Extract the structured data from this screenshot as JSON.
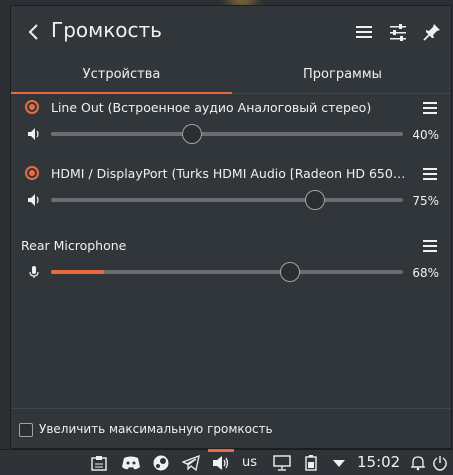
{
  "window": {
    "title": "Громкость",
    "tabs": [
      {
        "label": "Устройства",
        "active": true
      },
      {
        "label": "Программы",
        "active": false
      }
    ]
  },
  "devices": [
    {
      "name": "Line Out (Встроенное аудио Аналоговый стерео)",
      "selected": true,
      "volume_percent": 40,
      "volume_label": "40%",
      "fill_percent": 0,
      "icon": "speaker-icon"
    },
    {
      "name": "HDMI / DisplayPort (Turks HDMI Audio [Radeon HD 6500...",
      "selected": true,
      "volume_percent": 75,
      "volume_label": "75%",
      "fill_percent": 0,
      "icon": "speaker-icon"
    },
    {
      "name": "Rear Microphone",
      "selected": false,
      "volume_percent": 68,
      "volume_label": "68%",
      "fill_percent": 15,
      "icon": "microphone-icon"
    }
  ],
  "footer": {
    "raise_max_volume_label": "Увеличить максимальную громкость",
    "raise_max_volume_checked": false
  },
  "taskbar": {
    "keyboard_layout": "us",
    "clock": "15:02",
    "icons": [
      "clipboard-icon",
      "discord-icon",
      "steam-icon",
      "telegram-icon",
      "volume-icon",
      "display-icon",
      "battery-icon",
      "expand-arrow-icon",
      "notifications-icon",
      "power-icon"
    ]
  },
  "colors": {
    "accent": "#e86b3d",
    "background": "#31363b",
    "text": "#eff0f1"
  }
}
